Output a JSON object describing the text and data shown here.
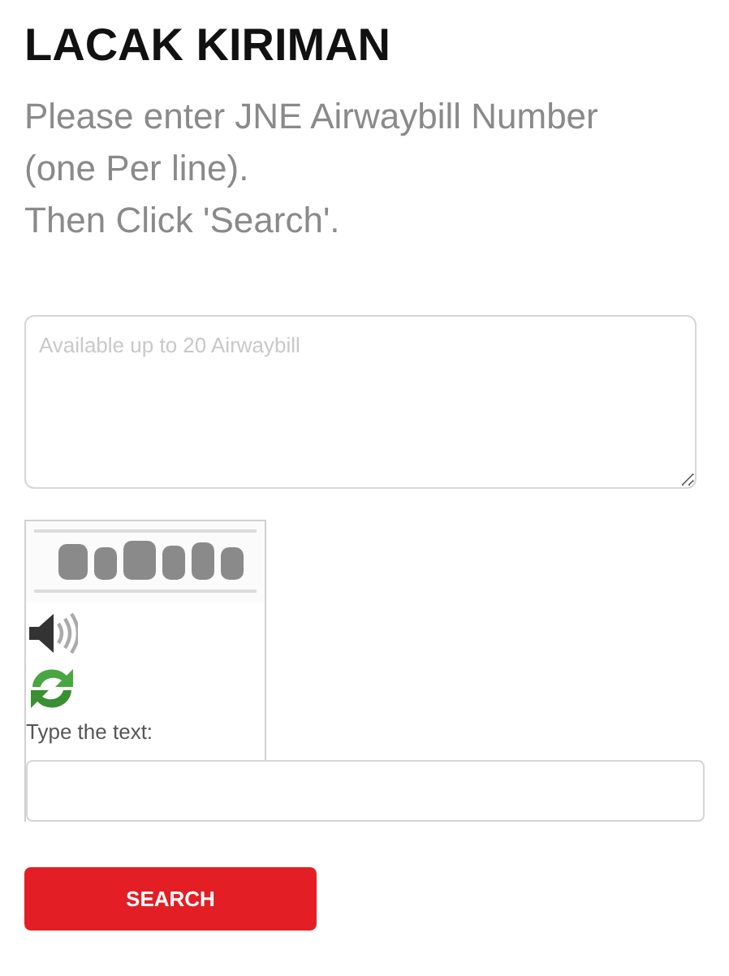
{
  "title": "LACAK KIRIMAN",
  "instructions": [
    "Please enter JNE Airwaybill Number (one Per line).",
    "Then Click 'Search'."
  ],
  "airwaybill_field": {
    "placeholder": "Available up to 20 Airwaybill"
  },
  "captcha": {
    "prompt": "Type the text:"
  },
  "search_button": "SEARCH"
}
